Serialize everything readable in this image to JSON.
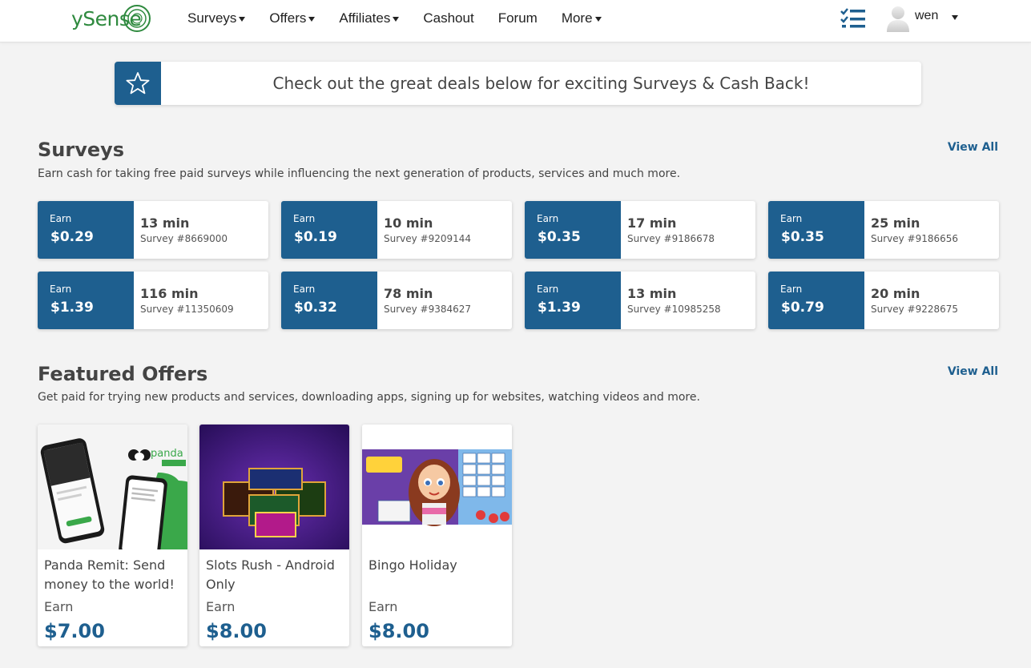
{
  "header": {
    "logo": "ySense",
    "nav": [
      {
        "label": "Surveys",
        "has_caret": true
      },
      {
        "label": "Offers",
        "has_caret": true
      },
      {
        "label": "Affiliates",
        "has_caret": true
      },
      {
        "label": "Cashout",
        "has_caret": false
      },
      {
        "label": "Forum",
        "has_caret": false
      },
      {
        "label": "More",
        "has_caret": true
      }
    ],
    "tasks_icon": "checklist-icon",
    "user": {
      "name": "wen",
      "avatar_icon": "user-avatar-icon"
    }
  },
  "banner": {
    "icon": "star-icon",
    "text": "Check out the great deals below for exciting Surveys & Cash Back!"
  },
  "surveys": {
    "title": "Surveys",
    "description": "Earn cash for taking free paid surveys while influencing the next generation of products, services and much more.",
    "view_all": "View All",
    "items": [
      {
        "earn_label": "Earn",
        "amount": "$0.29",
        "time": "13 min",
        "survey_id": "Survey #8669000"
      },
      {
        "earn_label": "Earn",
        "amount": "$0.19",
        "time": "10 min",
        "survey_id": "Survey #9209144"
      },
      {
        "earn_label": "Earn",
        "amount": "$0.35",
        "time": "17 min",
        "survey_id": "Survey #9186678"
      },
      {
        "earn_label": "Earn",
        "amount": "$0.35",
        "time": "25 min",
        "survey_id": "Survey #9186656"
      },
      {
        "earn_label": "Earn",
        "amount": "$1.39",
        "time": "116 min",
        "survey_id": "Survey #11350609"
      },
      {
        "earn_label": "Earn",
        "amount": "$0.32",
        "time": "78 min",
        "survey_id": "Survey #9384627"
      },
      {
        "earn_label": "Earn",
        "amount": "$1.39",
        "time": "13 min",
        "survey_id": "Survey #10985258"
      },
      {
        "earn_label": "Earn",
        "amount": "$0.79",
        "time": "20 min",
        "survey_id": "Survey #9228675"
      }
    ]
  },
  "offers": {
    "title": "Featured Offers",
    "description": "Get paid for trying new products and services, downloading apps, signing up for websites, watching videos and more.",
    "view_all": "View All",
    "items": [
      {
        "title": "Panda Remit: Send money to the world!",
        "earn_label": "Earn",
        "amount": "$7.00",
        "image": "panda-remit-app-screenshot"
      },
      {
        "title": "Slots Rush - Android Only",
        "earn_label": "Earn",
        "amount": "$8.00",
        "image": "slots-rush-game-art"
      },
      {
        "title": "Bingo Holiday",
        "earn_label": "Earn",
        "amount": "$8.00",
        "image": "bingo-holiday-game-art"
      }
    ]
  },
  "colors": {
    "primary": "#1e5f8f",
    "logo_green": "#2f8a3f",
    "background": "#f3f3f3"
  }
}
